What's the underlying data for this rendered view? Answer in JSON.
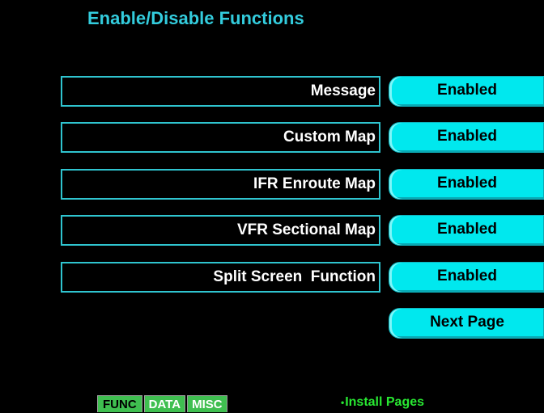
{
  "title": "Enable/Disable Functions",
  "functions": [
    {
      "label": "Message",
      "status": "Enabled"
    },
    {
      "label": "Custom Map",
      "status": "Enabled"
    },
    {
      "label": "IFR Enroute Map",
      "status": "Enabled"
    },
    {
      "label": "VFR Sectional Map",
      "status": "Enabled"
    },
    {
      "label": "Split Screen  Function",
      "status": "Enabled"
    }
  ],
  "next_page": {
    "label": "Next Page"
  },
  "tabs": [
    {
      "label": "FUNC"
    },
    {
      "label": "DATA"
    },
    {
      "label": "MISC"
    }
  ],
  "footer": {
    "bullet": "•",
    "label": "Install Pages"
  },
  "colors": {
    "background": "#000000",
    "title": "#33ccdd",
    "border": "#2fc4cf",
    "softkey": "#00e8ee",
    "tab": "#3fbf50",
    "footer_text": "#28e832"
  }
}
